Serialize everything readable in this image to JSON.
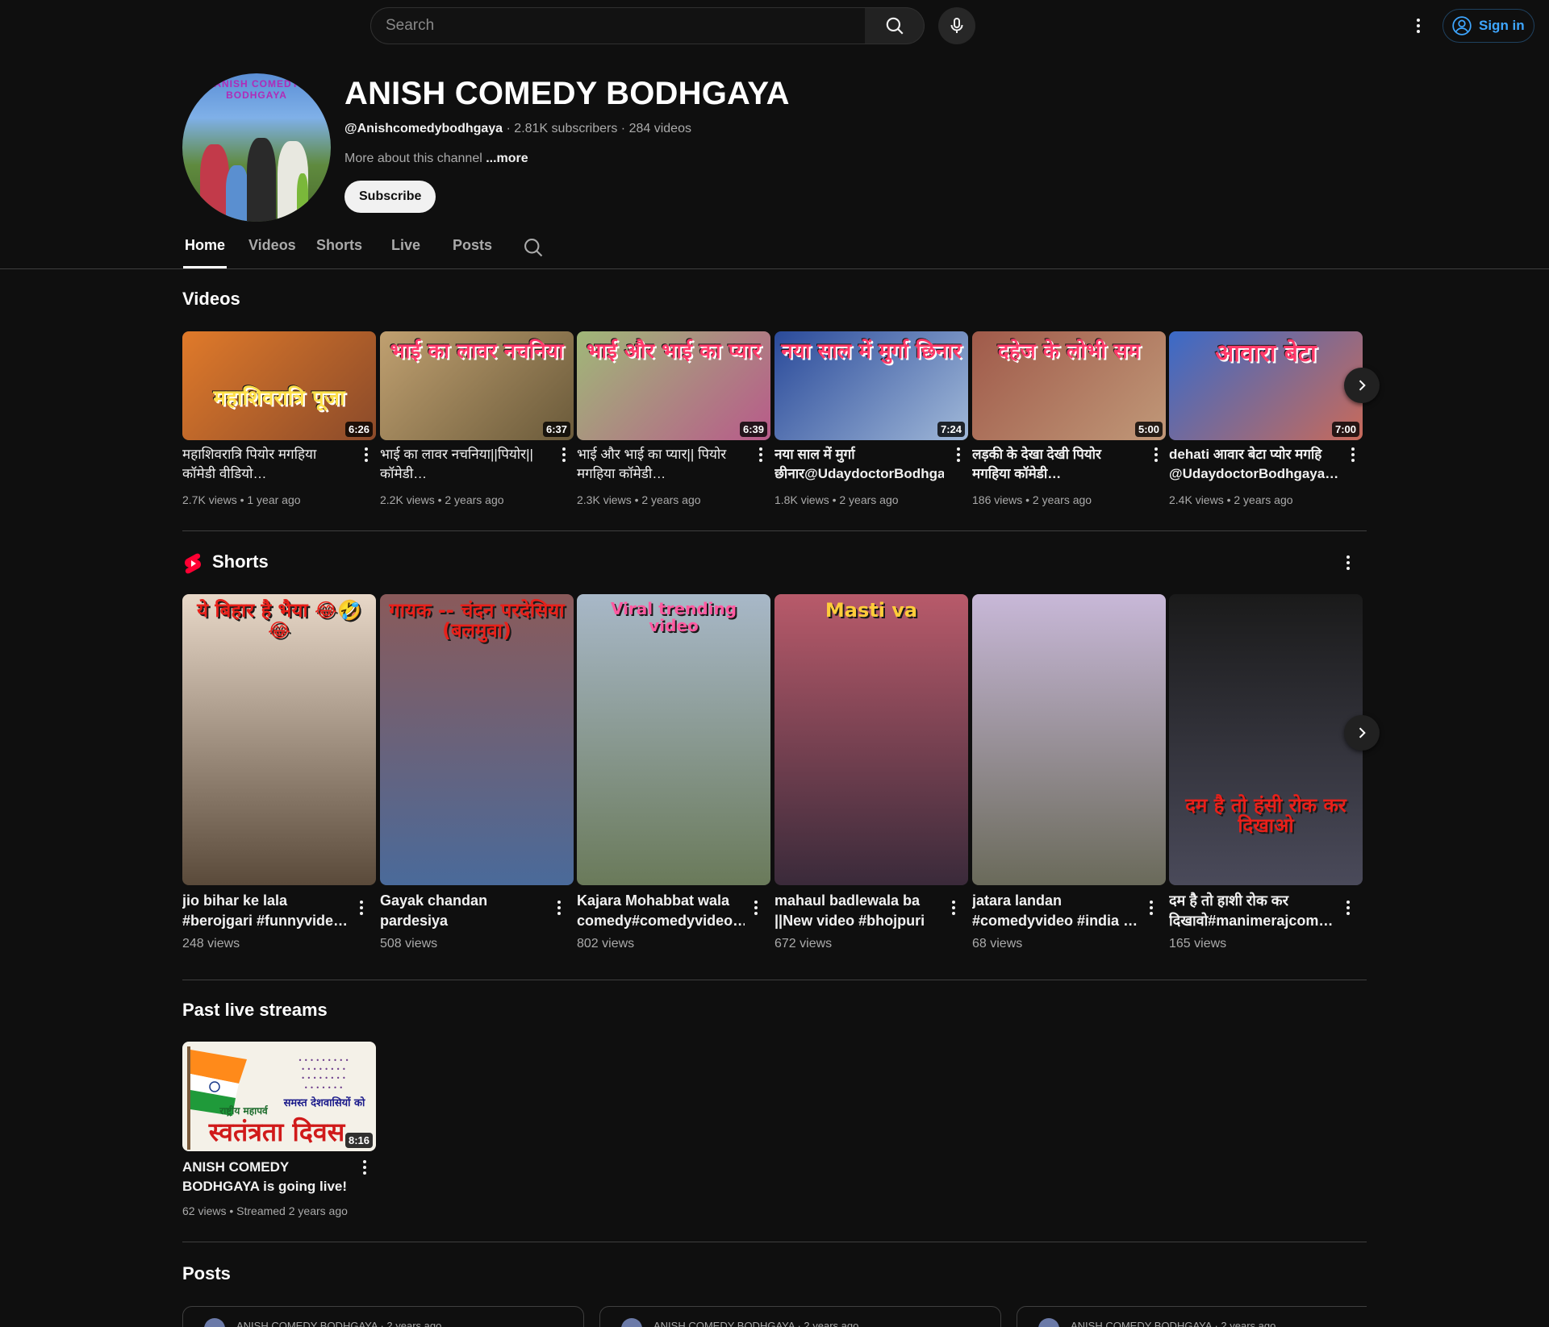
{
  "search": {
    "placeholder": "Search"
  },
  "header": {
    "signin_label": "Sign in"
  },
  "channel": {
    "avatar_text": "ANISH COMEDY BODHGAYA",
    "title": "ANISH COMEDY BODHGAYA",
    "handle": "@Anishcomedybodhgaya",
    "stats": " · 2.81K subscribers · 284 videos",
    "about": "More about this channel ",
    "more": "...more",
    "subscribe_label": "Subscribe"
  },
  "tabs": [
    {
      "label": "Home"
    },
    {
      "label": "Videos"
    },
    {
      "label": "Shorts"
    },
    {
      "label": "Live"
    },
    {
      "label": "Posts"
    }
  ],
  "videos_section": {
    "title": "Videos",
    "items": [
      {
        "title": "महाशिवरात्रि पियोर मगहिया कॉमेडी वीडियो…",
        "meta": "2.7K views • 1 year ago",
        "duration": "6:26",
        "thumb_text": "महाशिवरात्रि पूजा",
        "bg1": "#e07a2a",
        "bg2": "#8a4a2a"
      },
      {
        "title": "भाई का लावर नचनिया||पियोर|| कॉमेडी…",
        "meta": "2.2K views • 2 years ago",
        "duration": "6:37",
        "thumb_text": "भाई का लावर नचनिया",
        "bg1": "#c0a070",
        "bg2": "#6a5a3a"
      },
      {
        "title": "भाई और भाई का प्यार|| पियोर मगहिया कॉमेडी…",
        "meta": "2.3K views • 2 years ago",
        "duration": "6:39",
        "thumb_text": "भाई और भाई का प्यार",
        "bg1": "#a0b878",
        "bg2": "#b85a8a"
      },
      {
        "title": "नया साल में मुर्गा छीनार@UdaydoctorBodhgay…",
        "meta": "1.8K views • 2 years ago",
        "duration": "7:24",
        "thumb_text": "नया साल में मुर्गा छिनार",
        "bg1": "#2a4a9a",
        "bg2": "#a0b8d8"
      },
      {
        "title": "लड़की के देखा देखी पियोर मगहिया कॉमेडी…",
        "meta": "186 views • 2 years ago",
        "duration": "5:00",
        "thumb_text": "दहेज के लोभी सम",
        "bg1": "#a05a4a",
        "bg2": "#c09878"
      },
      {
        "title": "dehati आवार बेटा प्योर मगहि @UdaydoctorBodhgaya…",
        "meta": "2.4K views • 2 years ago",
        "duration": "7:00",
        "thumb_text": "आवारा बेटा",
        "bg1": "#3a6ac8",
        "bg2": "#c86a5a"
      }
    ]
  },
  "shorts_section": {
    "title": "Shorts",
    "items": [
      {
        "title": "jio bihar ke lala #berojgari #funnyvide…",
        "meta": "248 views",
        "thumb_text": "ये बिहार है भैया 😂🤣😂",
        "bg1": "#e8d8c8",
        "bg2": "#5a4a3a"
      },
      {
        "title": "Gayak chandan pardesiya #viralshorts…",
        "meta": "508 views",
        "thumb_text": "गायक -- चंदन परदेसिया (बलमुवा)",
        "bg1": "#8a5a5a",
        "bg2": "#4a6a9a"
      },
      {
        "title": "Kajara Mohabbat wala comedy#comedyvideo…",
        "meta": "802 views",
        "thumb_text": "Viral trending video",
        "bg1": "#a8b8c8",
        "bg2": "#6a7a5a"
      },
      {
        "title": "mahaul badlewala ba ||New video #bhojpuri …",
        "meta": "672 views",
        "thumb_text": "Masti va",
        "bg1": "#b85a6a",
        "bg2": "#3a2a3a"
      },
      {
        "title": "jatara landan #comedyvideo #india …",
        "meta": "68 views",
        "thumb_text": "",
        "bg1": "#c8b8d8",
        "bg2": "#6a6a5a"
      },
      {
        "title": "दम है तो हाशी रोक कर दिखावो#manimerajcom…",
        "meta": "165 views",
        "thumb_text": "दम है तो हंसी रोक कर दिखाओ",
        "bg1": "#1a1a1a",
        "bg2": "#4a4a5a"
      }
    ]
  },
  "live_section": {
    "title": "Past live streams",
    "items": [
      {
        "title": "ANISH COMEDY BODHGAYA is going live!",
        "meta": "62 views • Streamed 2 years ago",
        "duration": "8:16",
        "thumb_text": "स्वतंत्रता दिवस",
        "sub_text": "समस्त देशवासियों को",
        "prefix_text": "राष्ट्रीय महापर्व"
      }
    ]
  },
  "posts_section": {
    "title": "Posts",
    "author": "ANISH COMEDY BODHGAYA",
    "age": "2 years ago"
  }
}
